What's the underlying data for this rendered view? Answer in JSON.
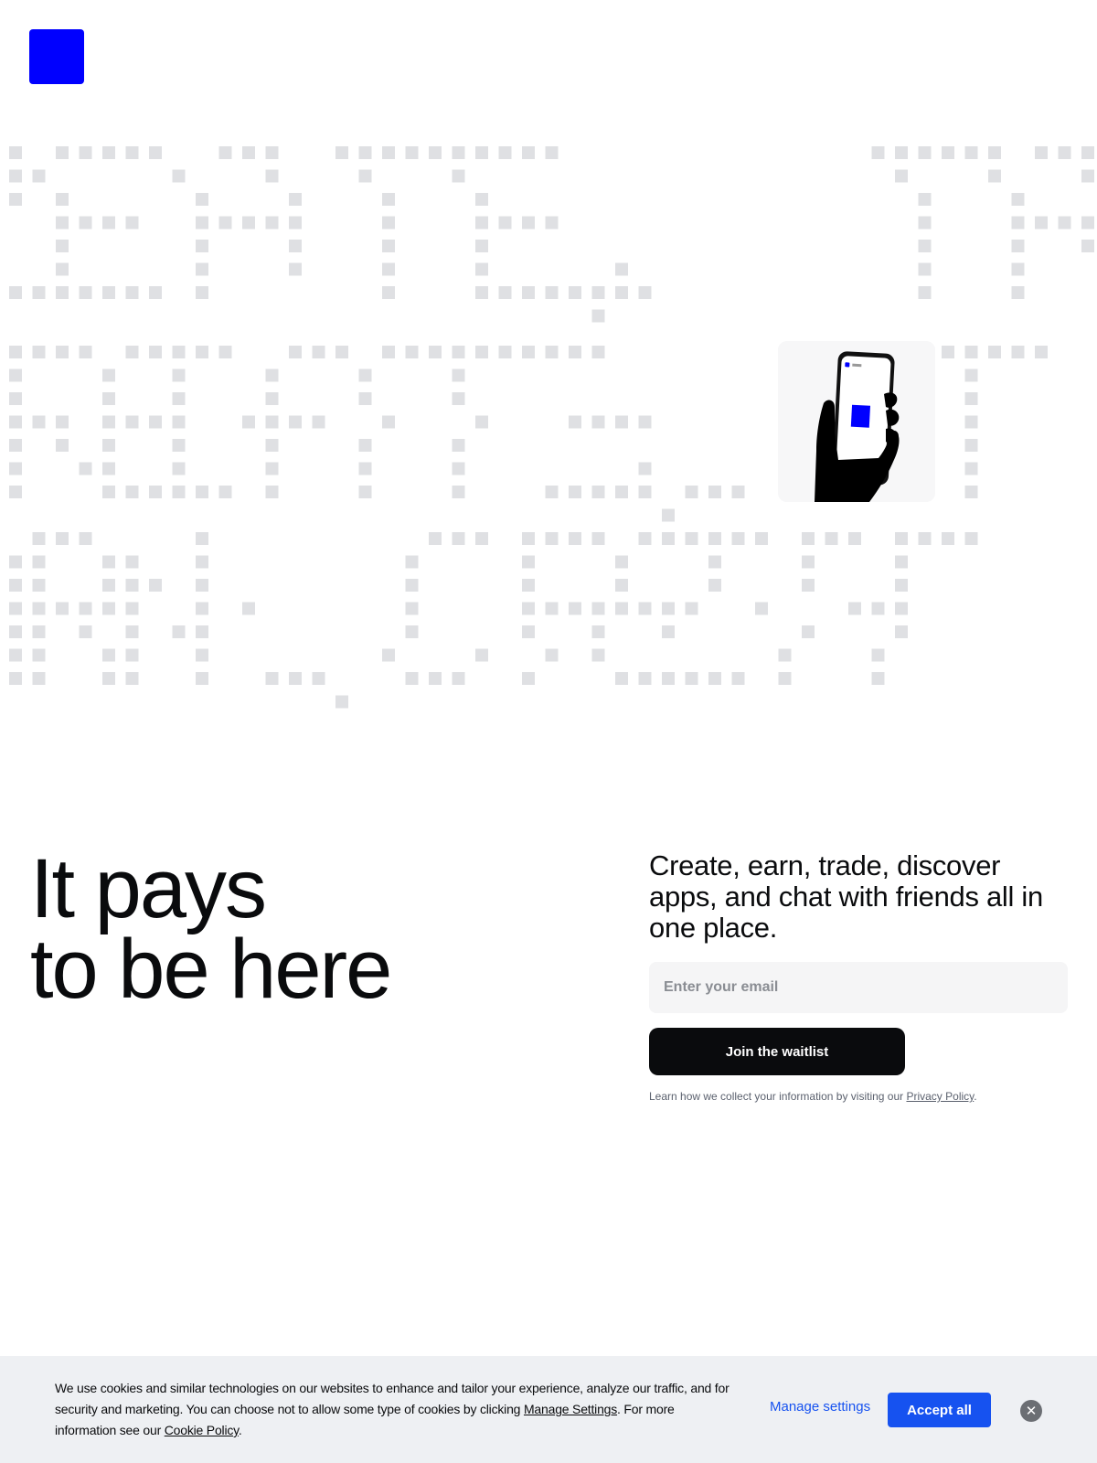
{
  "brand": {
    "logo_icon": "blue-square-logo-icon",
    "logo_color": "#0000ff"
  },
  "hero": {
    "background_pattern": "gray-pixel-letter-grid",
    "pixel_color": "#dfe0e3",
    "phone_card_icon": "hand-holding-phone-icon"
  },
  "headline": {
    "line1": "It pays",
    "line2": "to be here"
  },
  "signup": {
    "tagline": "Create, earn, trade, discover apps, and chat with friends all in one place.",
    "email_placeholder": "Enter your email",
    "email_value": "",
    "join_label": "Join the waitlist",
    "privacy_prefix": "Learn how we collect your information by visiting our ",
    "privacy_link": "Privacy Policy",
    "privacy_suffix": "."
  },
  "cookie_banner": {
    "text_part1": "We use cookies and similar technologies on our websites to enhance and tailor your experience, analyze our traffic, and for security and marketing. You can choose not to allow some type of cookies by clicking ",
    "manage_settings_inline": "Manage Settings",
    "text_part2": ". For more information see our ",
    "cookie_policy_link": "Cookie Policy",
    "text_part3": ".",
    "manage_button": "Manage settings",
    "accept_button": "Accept all",
    "close_icon": "close-icon"
  },
  "colors": {
    "accent_blue": "#1652f0",
    "text_primary": "#0a0b0d",
    "button_dark": "#0a0b0d",
    "cookie_bg": "#eef0f3"
  }
}
